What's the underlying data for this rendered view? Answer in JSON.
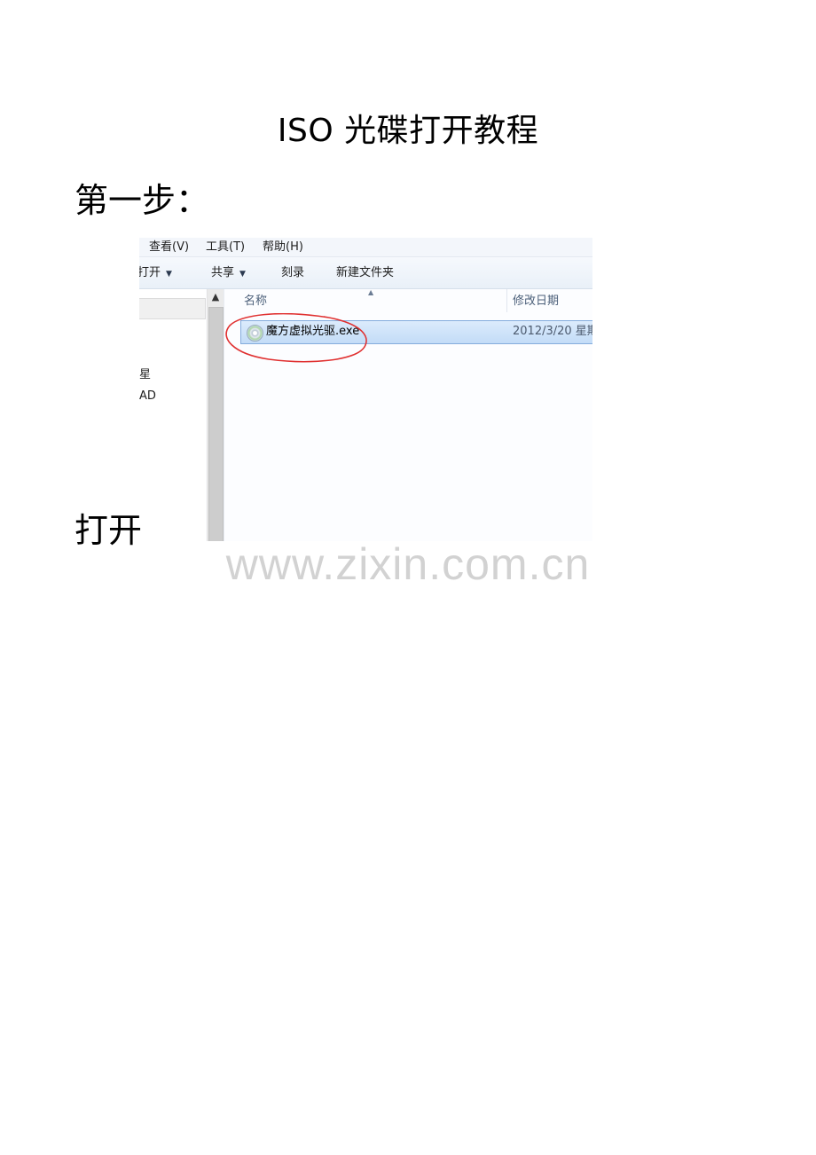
{
  "document": {
    "title": "ISO 光碟打开教程",
    "step1_heading": "第一步：",
    "open_label": "打开"
  },
  "watermark": "www.zixin.com.cn",
  "explorer": {
    "menu": [
      "查看(V)",
      "工具(T)",
      "帮助(H)"
    ],
    "toolbar": {
      "open": "打开",
      "share": "共享",
      "burn": "刻录",
      "new_folder": "新建文件夹"
    },
    "nav_pane": [
      "星",
      "AD"
    ],
    "columns": {
      "name": "名称",
      "modified": "修改日期"
    },
    "file": {
      "name": "魔方虚拟光驱.exe",
      "date": "2012/3/20 星期"
    },
    "icons": {
      "file": "disc-app-icon",
      "caret": "caret-down-icon",
      "scroll": "scroll-up-icon",
      "sort": "sort-up-icon"
    },
    "annotation_color": "#e03030"
  }
}
